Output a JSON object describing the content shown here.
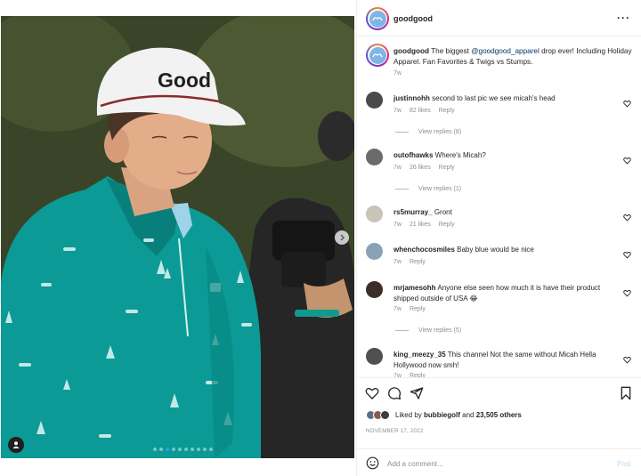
{
  "post": {
    "username": "goodgood",
    "caption": {
      "username": "goodgood",
      "text_before": " The biggest ",
      "mention": "@goodgood_apparel",
      "text_after": " drop ever! Including Holiday Apparel. Fan Favorites & Twigs vs Stumps.",
      "time": "7w"
    },
    "photo": {
      "cap_logo_text": "Good",
      "carousel_dot_count": 10,
      "carousel_active_index": 2
    }
  },
  "comments": [
    {
      "username": "justinnohh",
      "text": "second to last pic we see micah's head",
      "time": "7w",
      "likes": "82 likes",
      "reply": "Reply",
      "view_replies": "View replies (8)",
      "avatar_color": "#4a4a4a"
    },
    {
      "username": "outofhawks",
      "text": "Where's Micah?",
      "time": "7w",
      "likes": "26 likes",
      "reply": "Reply",
      "view_replies": "View replies (1)",
      "avatar_color": "#6b6b6b"
    },
    {
      "username": "rs5murray_",
      "text": "Gront",
      "time": "7w",
      "likes": "21 likes",
      "reply": "Reply",
      "view_replies": "",
      "avatar_color": "#c9c3b8"
    },
    {
      "username": "whenchocosmiles",
      "text": "Baby blue would be nice",
      "time": "7w",
      "likes": "",
      "reply": "Reply",
      "view_replies": "",
      "avatar_color": "#8aa2b8"
    },
    {
      "username": "mrjamesohh",
      "text": "Anyone else seen how much it is have their product shipped outside of USA 😂",
      "time": "7w",
      "likes": "",
      "reply": "Reply",
      "view_replies": "View replies (5)",
      "avatar_color": "#3d2f28"
    },
    {
      "username": "king_meezy_35",
      "text": "This channel Not the same without Micah Hella Hollywood now smh!",
      "time": "7w",
      "likes": "",
      "reply": "Reply",
      "view_replies": "",
      "avatar_color": "#505050"
    }
  ],
  "footer": {
    "liked_by_prefix": "Liked by ",
    "liked_by_user": "bubbiegolf",
    "liked_by_mid": " and ",
    "liked_by_count": "23,505 others",
    "date": "NOVEMBER 17, 2022",
    "comment_placeholder": "Add a comment...",
    "post_label": "Post"
  },
  "icons": {
    "more": "more-options-icon",
    "like": "heart-icon",
    "comment": "comment-icon",
    "share": "share-icon",
    "save": "bookmark-icon",
    "emoji": "emoji-icon",
    "next": "chevron-right-icon",
    "tag": "user-tag-icon"
  },
  "colors": {
    "mention": "#00376b",
    "secondary_text": "#8e8e8e",
    "post_button_disabled": "#b2dffc",
    "active_dot": "#3897f0",
    "shirt_teal": "#0b9a95"
  }
}
